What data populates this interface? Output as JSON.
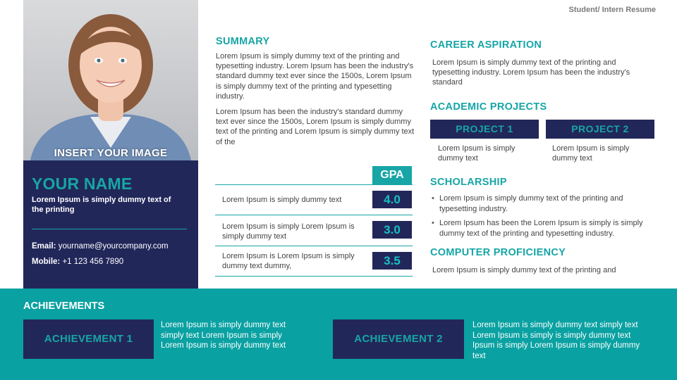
{
  "document": {
    "label": "Student/ Intern Resume"
  },
  "profile": {
    "photo_caption": "INSERT YOUR IMAGE",
    "name": "YOUR NAME",
    "tagline": "Lorem Ipsum is simply dummy text of the printing",
    "email_label": "Email:",
    "email": "yourname@yourcompany.com",
    "mobile_label": "Mobile:",
    "mobile": "+1 123 456 7890"
  },
  "summary": {
    "heading": "SUMMARY",
    "p1": "Lorem Ipsum is simply dummy text of the printing and typesetting industry. Lorem Ipsum has been the industry's standard dummy text ever since the 1500s, Lorem Ipsum is simply dummy text of the printing and typesetting industry.",
    "p2": "Lorem Ipsum has been the industry's standard dummy text ever since the 1500s, Lorem Ipsum is simply dummy text of the printing and Lorem Ipsum is simply dummy text of the"
  },
  "gpa": {
    "heading": "GPA",
    "rows": [
      {
        "text": "Lorem Ipsum is simply dummy text",
        "value": "4.0"
      },
      {
        "text": "Lorem Ipsum is simply Lorem Ipsum is simply dummy text",
        "value": "3.0"
      },
      {
        "text": "Lorem Ipsum is Lorem Ipsum is simply dummy text dummy,",
        "value": "3.5"
      }
    ]
  },
  "career": {
    "heading": "CAREER ASPIRATION",
    "text": "Lorem Ipsum is simply dummy text of the printing and typesetting industry. Lorem Ipsum has been the industry's standard"
  },
  "projects": {
    "heading": "ACADEMIC PROJECTS",
    "items": [
      {
        "label": "PROJECT 1",
        "text": "Lorem Ipsum is simply dummy text"
      },
      {
        "label": "PROJECT 2",
        "text": "Lorem Ipsum is simply dummy text"
      }
    ]
  },
  "scholarship": {
    "heading": "SCHOLARSHIP",
    "items": [
      "Lorem Ipsum is simply dummy text of the printing and typesetting industry.",
      "Lorem Ipsum has been the Lorem Ipsum is simply is simply dummy text of the printing and typesetting industry."
    ]
  },
  "computer": {
    "heading": "COMPUTER PROFICIENCY",
    "text": "Lorem Ipsum is simply dummy text of the printing and"
  },
  "achievements": {
    "heading": "ACHIEVEMENTS",
    "items": [
      {
        "label": "ACHIEVEMENT 1",
        "text": "Lorem Ipsum is simply dummy text simply text Lorem Ipsum is simply Lorem Ipsum is simply dummy text"
      },
      {
        "label": "ACHIEVEMENT 2",
        "text": "Lorem Ipsum is simply dummy text simply text Lorem Ipsum is simply is simply dummy text Ipsum is simply Lorem Ipsum is simply dummy text"
      }
    ]
  },
  "colors": {
    "navy": "#22275a",
    "teal": "#17a5a6",
    "band": "#0aa1a2"
  }
}
